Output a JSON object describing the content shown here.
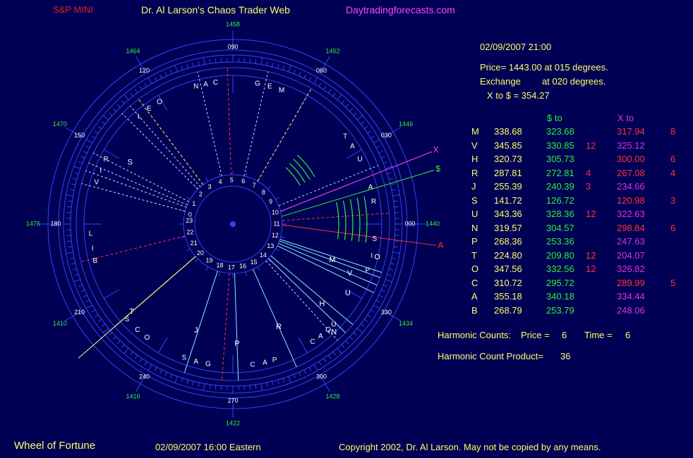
{
  "header": {
    "symbol": "S&P MINI",
    "title": "Dr. Al Larson's Chaos Trader Web",
    "site": "Daytradingforecasts.com"
  },
  "info": {
    "datetime": "02/09/2007 21:00",
    "price_line": "Price= 1443.00 at 015 degrees.",
    "exchange_label": "Exchange",
    "exchange_deg": "at 020 degrees.",
    "x_to_dollar": "X to $  = 354.27"
  },
  "table": {
    "head_dollar": "$ to",
    "head_x": "X to",
    "rows": [
      {
        "l": "M",
        "v": "338.68",
        "s": "323.68",
        "sh": "",
        "x": "317.94",
        "xh": "8",
        "xhl": true
      },
      {
        "l": "V",
        "v": "345.85",
        "s": "330.85",
        "sh": "12",
        "x": "325.12",
        "xh": "",
        "xhl": false
      },
      {
        "l": "H",
        "v": "320.73",
        "s": "305.73",
        "sh": "",
        "x": "300.00",
        "xh": "6",
        "xhl": true
      },
      {
        "l": "R",
        "v": "287.81",
        "s": "272.81",
        "sh": "4",
        "x": "267.08",
        "xh": "4",
        "xhl": true
      },
      {
        "l": "J",
        "v": "255.39",
        "s": "240.39",
        "sh": "3",
        "x": "234.66",
        "xh": "",
        "xhl": false
      },
      {
        "l": "S",
        "v": "141.72",
        "s": "126.72",
        "sh": "",
        "x": "120.98",
        "xh": "3",
        "xhl": true
      },
      {
        "l": "U",
        "v": "343.36",
        "s": "328.36",
        "sh": "12",
        "x": "322.63",
        "xh": "",
        "xhl": false
      },
      {
        "l": "N",
        "v": "319.57",
        "s": "304.57",
        "sh": "",
        "x": "298.84",
        "xh": "6",
        "xhl": true
      },
      {
        "l": "P",
        "v": "268.36",
        "s": "253.36",
        "sh": "",
        "x": "247.63",
        "xh": "",
        "xhl": false
      },
      {
        "l": "T",
        "v": "224.80",
        "s": "209.80",
        "sh": "12",
        "x": "204.07",
        "xh": "",
        "xhl": false
      },
      {
        "l": "O",
        "v": "347.56",
        "s": "332.56",
        "sh": "12",
        "x": "326.82",
        "xh": "",
        "xhl": false
      },
      {
        "l": "C",
        "v": "310.72",
        "s": "295.72",
        "sh": "",
        "x": "289.99",
        "xh": "5",
        "xhl": true
      },
      {
        "l": "A",
        "v": "355.18",
        "s": "340.18",
        "sh": "",
        "x": "334.44",
        "xh": "",
        "xhl": false
      },
      {
        "l": "B",
        "v": "268.79",
        "s": "253.79",
        "sh": "",
        "x": "248.06",
        "xh": "",
        "xhl": false
      }
    ]
  },
  "harmonics": {
    "counts_label": "Harmonic Counts:",
    "price_label": "Price =",
    "price_value": "6",
    "time_label": "Time =",
    "time_value": "6",
    "product_label": "Harmonic Count Product=",
    "product_value": "36"
  },
  "footer": {
    "left": "Wheel of Fortune",
    "mid": "02/09/2007 16:00 Eastern",
    "right": "Copyright 2002, Dr. Al Larson. May not be copied by any means."
  },
  "wheel": {
    "degree_labels": [
      "000",
      "030",
      "060",
      "090",
      "120",
      "150",
      "180",
      "210",
      "240",
      "270",
      "300",
      "330"
    ],
    "price_labels": [
      "1440",
      "1446",
      "1452",
      "1458",
      "1464",
      "1470",
      "1476",
      "1410",
      "1416",
      "1422",
      "1428",
      "1434"
    ],
    "hour_labels": [
      "0",
      "1",
      "2",
      "3",
      "4",
      "5",
      "6",
      "7",
      "8",
      "9",
      "10",
      "11",
      "12",
      "13",
      "14",
      "15",
      "16",
      "17",
      "18",
      "19",
      "20",
      "21",
      "22",
      "23"
    ],
    "outer_letters": [
      {
        "t": "S",
        "a": -6
      },
      {
        "t": "I",
        "a": -13
      },
      {
        "t": "P",
        "a": -19
      },
      {
        "t": "U",
        "a": -45
      },
      {
        "t": "Q",
        "a": -48
      },
      {
        "t": "A",
        "a": -52
      },
      {
        "t": "C",
        "a": -56
      },
      {
        "t": "P",
        "a": -73
      },
      {
        "t": "A",
        "a": -77
      },
      {
        "t": "C",
        "a": -82
      },
      {
        "t": "G",
        "a": -100
      },
      {
        "t": "A",
        "a": -105
      },
      {
        "t": "S",
        "a": -110
      },
      {
        "t": "O",
        "a": -127
      },
      {
        "t": "C",
        "a": -132
      },
      {
        "t": "S",
        "a": -138
      },
      {
        "t": "B",
        "a": -165
      },
      {
        "t": "I",
        "a": -170
      },
      {
        "t": "L",
        "a": -176
      },
      {
        "t": "V",
        "a": -197
      },
      {
        "t": "I",
        "a": -202
      },
      {
        "t": "R",
        "a": -207
      },
      {
        "t": "L",
        "a": -229
      },
      {
        "t": "E",
        "a": -234
      },
      {
        "t": "O",
        "a": -239
      },
      {
        "t": "C",
        "a": -263
      },
      {
        "t": "A",
        "a": -259
      },
      {
        "t": "N",
        "a": -255
      },
      {
        "t": "G",
        "a": -280
      },
      {
        "t": "E",
        "a": -285
      },
      {
        "t": "M",
        "a": -290
      },
      {
        "t": "T",
        "a": -322
      },
      {
        "t": "A",
        "a": -327
      },
      {
        "t": "U",
        "a": -333
      },
      {
        "t": "A",
        "a": -345
      },
      {
        "t": "R",
        "a": -351
      }
    ],
    "inner_letters": [
      {
        "t": "V",
        "a": -23,
        "r": 180
      },
      {
        "t": "M",
        "a": -20,
        "r": 150
      },
      {
        "t": "U",
        "a": -31,
        "r": 190
      },
      {
        "t": "O",
        "a": -13,
        "r": 210
      },
      {
        "t": "H",
        "a": -42,
        "r": 170
      },
      {
        "t": "N",
        "a": -47,
        "r": 210
      },
      {
        "t": "R",
        "a": -66,
        "r": 160
      },
      {
        "t": "P",
        "a": -88,
        "r": 170
      },
      {
        "t": "J",
        "a": -109,
        "r": 160
      },
      {
        "t": "T",
        "a": -139,
        "r": 190
      },
      {
        "t": "S",
        "a": -211,
        "r": 170
      }
    ],
    "line_labels": [
      {
        "t": "X",
        "color": "#ff44ff"
      },
      {
        "t": "$",
        "color": "#33ee33"
      },
      {
        "t": "A",
        "color": "#ff3333"
      }
    ],
    "colors": {
      "ring": "#3344ff",
      "x_line": "#ff44ff",
      "dollar_line": "#33ee33",
      "a_line": "#ff3333",
      "planet_line": "#88eeff",
      "t_line": "#ffff66",
      "dashed_yellow": "#ffff66",
      "dashed_white": "#ddddff",
      "dashed_red": "#ff3333",
      "arc_green": "#33ee33"
    }
  }
}
